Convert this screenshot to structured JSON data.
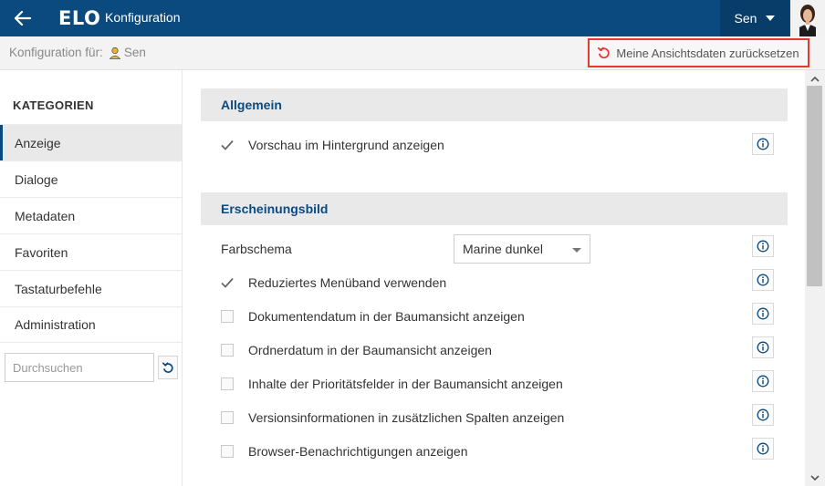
{
  "header": {
    "logo": "ELO",
    "title": "Konfiguration",
    "user_name": "Sen",
    "back_icon": "arrow-left-icon",
    "colors": {
      "header_bg": "#0b4a7e",
      "accent_red": "#e53935"
    }
  },
  "subbar": {
    "config_for_label": "Konfiguration für:",
    "config_for_user": "Sen",
    "reset_button_label": "Meine Ansichtsdaten zurücksetzen"
  },
  "sidebar": {
    "heading": "KATEGORIEN",
    "items": [
      {
        "label": "Anzeige",
        "active": true
      },
      {
        "label": "Dialoge",
        "active": false
      },
      {
        "label": "Metadaten",
        "active": false
      },
      {
        "label": "Favoriten",
        "active": false
      },
      {
        "label": "Tastaturbefehle",
        "active": false
      },
      {
        "label": "Administration",
        "active": false
      }
    ],
    "search_placeholder": "Durchsuchen"
  },
  "sections": {
    "general": {
      "title": "Allgemein",
      "options": [
        {
          "label": "Vorschau im Hintergrund anzeigen",
          "checked": true
        }
      ]
    },
    "appearance": {
      "title": "Erscheinungsbild",
      "color_scheme_label": "Farbschema",
      "color_scheme_value": "Marine dunkel",
      "options": [
        {
          "label": "Reduziertes Menüband verwenden",
          "checked": true
        },
        {
          "label": "Dokumentendatum in der Baumansicht anzeigen",
          "checked": false
        },
        {
          "label": "Ordnerdatum in der Baumansicht anzeigen",
          "checked": false
        },
        {
          "label": "Inhalte der Prioritätsfelder in der Baumansicht anzeigen",
          "checked": false
        },
        {
          "label": "Versionsinformationen in zusätzlichen Spalten anzeigen",
          "checked": false
        },
        {
          "label": "Browser-Benachrichtigungen anzeigen",
          "checked": false
        }
      ]
    }
  }
}
